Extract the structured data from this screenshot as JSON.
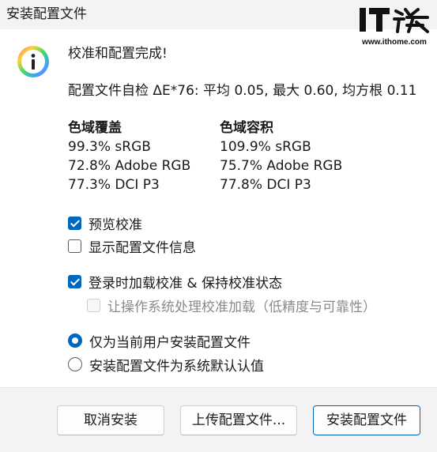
{
  "window": {
    "title": "安装配置文件"
  },
  "watermark": {
    "logo_text": "IT之家",
    "url": "www.ithome.com"
  },
  "icon": {
    "name": "info-icon",
    "glyph": "i"
  },
  "content": {
    "heading": "校准和配置完成!",
    "self_check": "配置文件自检 ΔE*76: 平均 0.05, 最大 0.60, 均方根 0.11",
    "gamut_coverage": {
      "title": "色域覆盖",
      "rows": [
        "99.3% sRGB",
        "72.8% Adobe RGB",
        "77.3% DCI P3"
      ]
    },
    "gamut_volume": {
      "title": "色域容积",
      "rows": [
        "109.9% sRGB",
        "75.7% Adobe RGB",
        "77.8% DCI P3"
      ]
    }
  },
  "options": {
    "preview_calibration": {
      "label": "预览校准",
      "checked": true
    },
    "show_profile_info": {
      "label": "显示配置文件信息",
      "checked": false
    },
    "load_on_login": {
      "label": "登录时加载校准 & 保持校准状态",
      "checked": true
    },
    "os_handle_loading": {
      "label": "让操作系统处理校准加载（低精度与可靠性）",
      "checked": false,
      "disabled": true
    }
  },
  "install_scope": {
    "current_user": {
      "label": "仅为当前用户安装配置文件",
      "selected": true
    },
    "system_default": {
      "label": "安装配置文件为系统默认认值",
      "selected": false
    }
  },
  "buttons": {
    "cancel": "取消安装",
    "upload": "上传配置文件...",
    "install": "安装配置文件"
  },
  "colors": {
    "accent": "#0067c0",
    "title_bar": "#f3f3f3",
    "footer": "#f3f3f3"
  }
}
